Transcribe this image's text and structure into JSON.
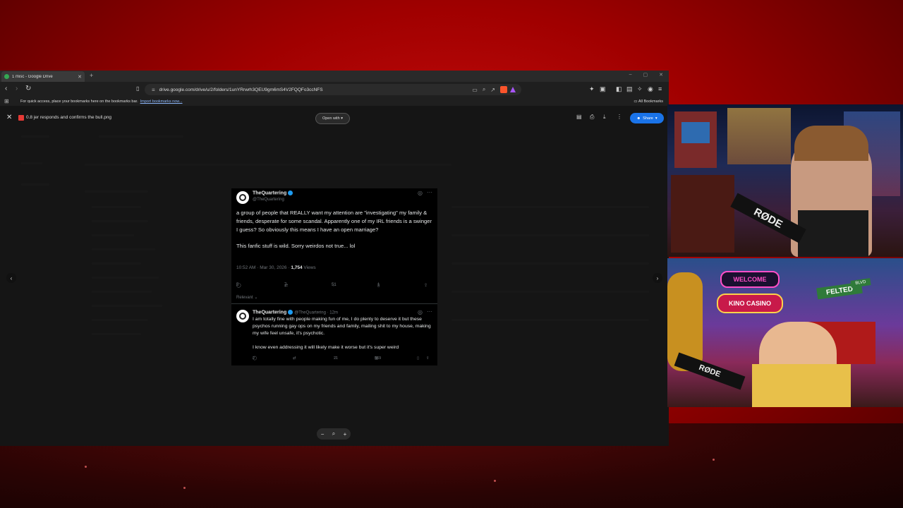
{
  "tab": {
    "title": "1 misc - Google Drive",
    "new_tab": "+"
  },
  "window_controls": [
    "–",
    "▢",
    "✕"
  ],
  "address": {
    "url": "drive.google.com/drive/u/2/folders/1unYRrwrh3QEU9gm6mS4V2FQQFo3ccNFS"
  },
  "bookmarks": {
    "message": "For quick access, place your bookmarks here on the bookmarks bar.",
    "import_link": "Import bookmarks now...",
    "all_bookmarks": "All Bookmarks"
  },
  "viewer": {
    "file_name": "0.8 jer responds and confirms the bull.png",
    "open_with": "Open with",
    "share": "Share",
    "prev": "‹",
    "next": "›",
    "zoom_out": "−",
    "zoom_icon": "⌕",
    "zoom_in": "+"
  },
  "tweet": {
    "name": "TheQuartering",
    "handle": "@TheQuartering",
    "body": "a group of people that REALLY want my attention are \"investigating\" my family & friends, desperate for some scandal. Apparently one of my IRL friends is a swinger I guess? So obviously this means I have an open marriage?",
    "body2": "This fanfic stuff is wild. Sorry weirdos not true... lol",
    "timestamp": "10:52 AM · Mar 30, 2026 · ",
    "views_count": "1,754",
    "views_label": " Views",
    "replies": "5",
    "retweets": "7",
    "likes": "51",
    "bookmarks": "1",
    "sort": "Relevant ⌄"
  },
  "reply": {
    "name": "TheQuartering",
    "handle_time": "@TheQuartering · 12m",
    "body": "I am totally fine with people making fun of me, I do plenty to deserve it but these psychos running gay ops on my friends and family, mailing shit to my house, making my wife feel unsafe, it's psychotic.",
    "body2": "I know even addressing it will likely make it worse but it's super weird",
    "replies": "2",
    "likes": "21",
    "views": "569"
  },
  "stream": {
    "mic_brand": "RØDE",
    "sign_welcome": "WELCOME",
    "sign_casino": "KINO CASINO",
    "sign_street": "FELTED",
    "sign_blvd": "BLVD"
  }
}
